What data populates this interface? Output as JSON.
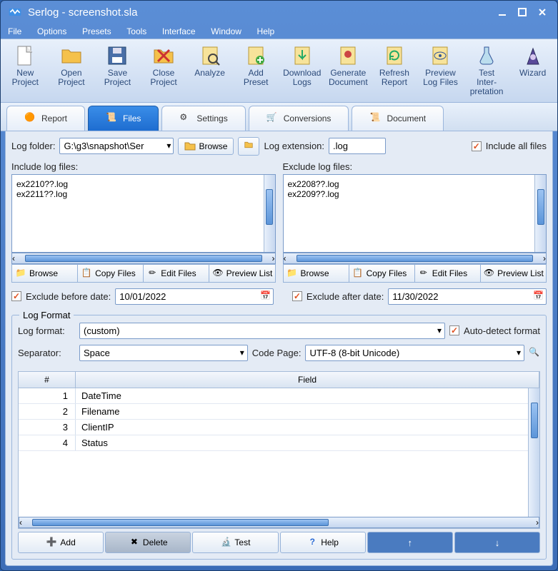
{
  "title": "Serlog - screenshot.sla",
  "menu": [
    "File",
    "Options",
    "Presets",
    "Tools",
    "Interface",
    "Window",
    "Help"
  ],
  "toolbar": [
    {
      "label": "New Project",
      "icon": "file-new"
    },
    {
      "label": "Open Project",
      "icon": "folder-open"
    },
    {
      "label": "Save Project",
      "icon": "save"
    },
    {
      "label": "Close Project",
      "icon": "folder-close"
    },
    {
      "label": "Analyze",
      "icon": "analyze"
    },
    {
      "label": "Add Preset",
      "icon": "add-preset"
    },
    {
      "label": "Download Logs",
      "icon": "download"
    },
    {
      "label": "Generate Document",
      "icon": "generate"
    },
    {
      "label": "Refresh Report",
      "icon": "refresh"
    },
    {
      "label": "Preview Log Files",
      "icon": "preview"
    },
    {
      "label": "Test Inter-pretation",
      "icon": "test"
    },
    {
      "label": "Wizard",
      "icon": "wizard"
    }
  ],
  "tabs": [
    "Report",
    "Files",
    "Settings",
    "Conversions",
    "Document"
  ],
  "activeTab": "Files",
  "logFolder": {
    "label": "Log folder:",
    "value": "G:\\g3\\snapshot\\Ser",
    "browse": "Browse"
  },
  "logExtension": {
    "label": "Log extension:",
    "value": ".log"
  },
  "includeAll": {
    "label": "Include all files",
    "checked": true
  },
  "includeFiles": {
    "label": "Include log files:",
    "items": [
      "ex2210??.log",
      "ex2211??.log"
    ]
  },
  "excludeFiles": {
    "label": "Exclude log files:",
    "items": [
      "ex2208??.log",
      "ex2209??.log"
    ]
  },
  "fileButtons": [
    "Browse",
    "Copy Files",
    "Edit Files",
    "Preview List"
  ],
  "excludeBefore": {
    "label": "Exclude before date:",
    "value": "10/01/2022",
    "checked": true
  },
  "excludeAfter": {
    "label": "Exclude after date:",
    "value": "11/30/2022",
    "checked": true
  },
  "logFormat": {
    "legend": "Log Format",
    "formatLabel": "Log format:",
    "formatValue": "(custom)",
    "autoDetect": {
      "label": "Auto-detect format",
      "checked": true
    },
    "separatorLabel": "Separator:",
    "separatorValue": "Space",
    "codePageLabel": "Code Page:",
    "codePageValue": "UTF-8 (8-bit Unicode)",
    "headers": {
      "num": "#",
      "field": "Field"
    },
    "rows": [
      {
        "n": "1",
        "v": "DateTime"
      },
      {
        "n": "2",
        "v": "Filename"
      },
      {
        "n": "3",
        "v": "ClientIP"
      },
      {
        "n": "4",
        "v": "Status"
      }
    ]
  },
  "bottom": {
    "add": "Add",
    "delete": "Delete",
    "test": "Test",
    "help": "Help"
  }
}
